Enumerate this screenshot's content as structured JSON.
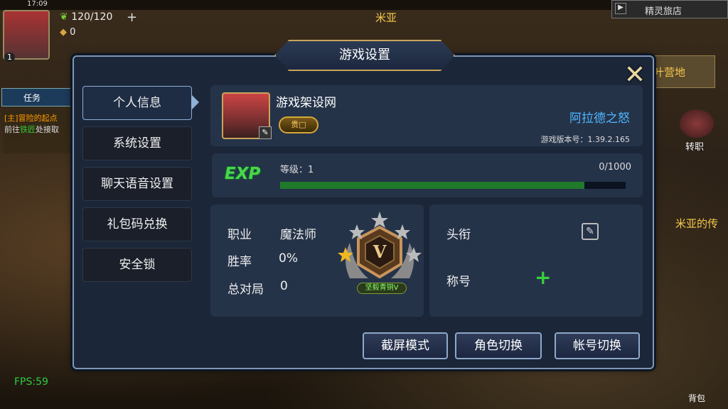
{
  "hud": {
    "clock": "17:09",
    "player_level": "1",
    "energy": "120/120",
    "gold": "0",
    "task_label": "任务",
    "quest_title": "[主]冒险的起点",
    "quest_desc_prefix": "前往",
    "quest_desc_link": "铁匠",
    "quest_desc_suffix": "处接取",
    "location_name": "米亚",
    "inn_title": "精灵旅店",
    "camp_label": "叶营地",
    "job_change_label": "转职",
    "miya_legend": "米亚的传",
    "bag_label": "背包",
    "fps": "FPS:59"
  },
  "dialog": {
    "title": "游戏设置",
    "close_symbol": "✕"
  },
  "menu": {
    "items": [
      {
        "label": "个人信息"
      },
      {
        "label": "系统设置"
      },
      {
        "label": "聊天语音设置"
      },
      {
        "label": "礼包码兑换"
      },
      {
        "label": "安全锁"
      }
    ],
    "active_index": 0
  },
  "profile": {
    "name": "游戏架设网",
    "rank_badge": "贵□",
    "server": "阿拉德之怒",
    "version": "游戏版本号：1.39.2.165"
  },
  "exp": {
    "label": "EXP",
    "level": "等级：1",
    "value_text": "0/1000",
    "progress": 0.88
  },
  "stats": {
    "job_label": "职业",
    "job_value": "魔法师",
    "winrate_label": "胜率",
    "winrate_value": "0%",
    "total_label": "总对局",
    "total_value": "0",
    "medal_roman": "V",
    "medal_caption": "坚毅青铜V"
  },
  "titles": {
    "head_title_label": "头衔",
    "nickname_label": "称号"
  },
  "buttons": {
    "screenshot": "截屏模式",
    "switch_role": "角色切换",
    "switch_account": "帐号切换"
  },
  "colors": {
    "server": "#4fb6ff",
    "exp_bar": "#1f7a2a",
    "exp_label": "#4ad64a",
    "dialog_bg": "#1b2638",
    "border_gold": "#c9a45a"
  }
}
